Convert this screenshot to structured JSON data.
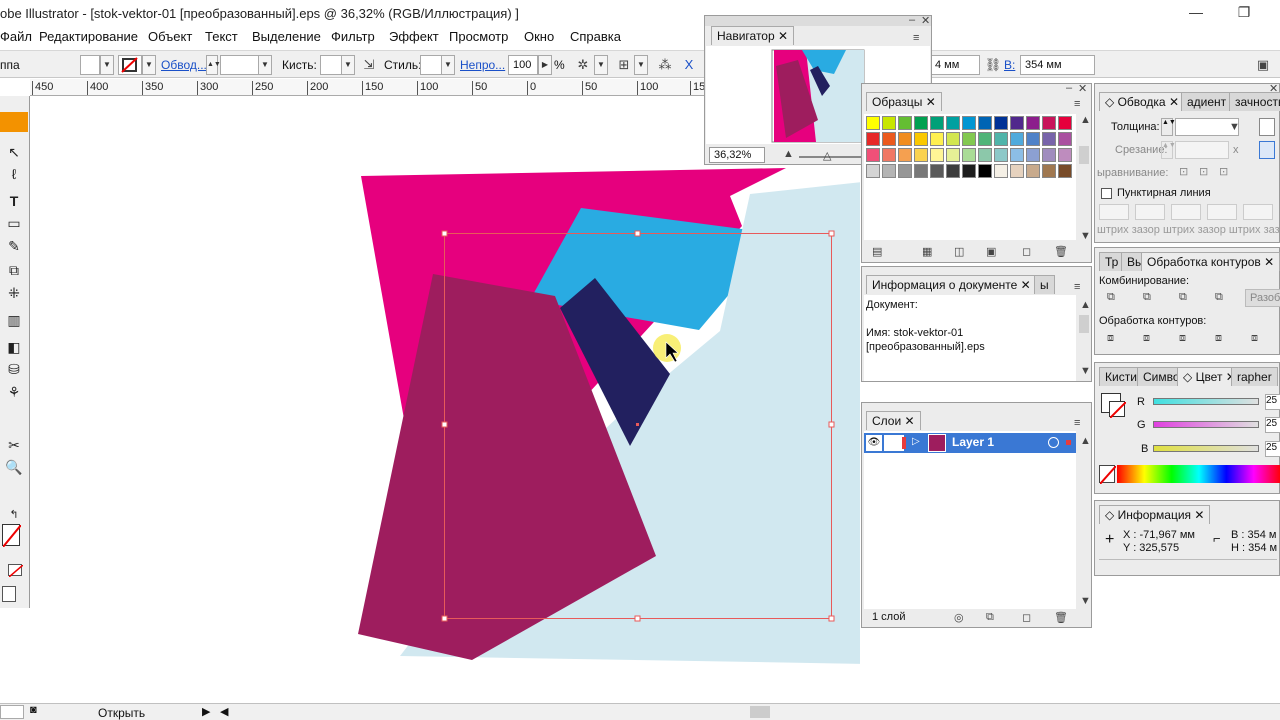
{
  "window": {
    "title": "obe Illustrator - [stok-vektor-01 [преобразованный].eps @ 36,32% (RGB/Иллюстрация) ]",
    "minimize": "—",
    "restore": "❐"
  },
  "menu": [
    "Файл",
    "Редактирование",
    "Объект",
    "Текст",
    "Выделение",
    "Фильтр",
    "Эффект",
    "Просмотр",
    "Окно",
    "Справка"
  ],
  "controlbar": {
    "group_label": "ппа",
    "stroke_link": "Обвод...",
    "brush_label": "Кисть:",
    "style_label": "Стиль:",
    "opacity_link": "Непро...",
    "opacity_value": "100",
    "opacity_unit": "%",
    "w_value": "4 мм",
    "h_label": "В:",
    "h_value": "354 мм"
  },
  "ruler": [
    "450",
    "400",
    "350",
    "300",
    "250",
    "200",
    "150",
    "100",
    "50",
    "0",
    "50",
    "100",
    "150"
  ],
  "navigator": {
    "title": "Навигатор",
    "zoom": "36,32%"
  },
  "swatches": {
    "title": "Образцы",
    "colors": [
      "#ffff00",
      "#c8e600",
      "#64be32",
      "#00a050",
      "#00a078",
      "#00a0a0",
      "#0096d2",
      "#0064b4",
      "#003296",
      "#50288c",
      "#8c1e8c",
      "#c8145a",
      "#e6003c",
      "#e62828",
      "#eb5a1e",
      "#f08c1e",
      "#fac800",
      "#fff050",
      "#d2e650",
      "#82c850",
      "#50b478",
      "#50b4aa",
      "#50aadc",
      "#5082c8",
      "#7864aa",
      "#aa50a0",
      "#f05078",
      "#f07864",
      "#f5a050",
      "#fad250",
      "#fff596",
      "#e6f096",
      "#aadc96",
      "#8cc8aa",
      "#8cc8c8",
      "#8cbee6",
      "#8ca0d2",
      "#a08cbe",
      "#be8cbe",
      "#d4d4d4",
      "#b4b4b4",
      "#969696",
      "#787878",
      "#5a5a5a",
      "#3c3c3c",
      "#1e1e1e",
      "#000000",
      "#f5f0e6",
      "#e6d2be",
      "#c8aa8c",
      "#a07850",
      "#784b28"
    ]
  },
  "docinfo": {
    "title": "Информация о документе",
    "header": "Документ:",
    "name_line1": "Имя: stok-vektor-01",
    "name_line2": "[преобразованный].eps"
  },
  "layers": {
    "title": "Слои",
    "layer_name": "Layer 1",
    "count": "1 слой"
  },
  "stroke": {
    "tab1": "Обводка",
    "tab2": "адиент",
    "tab3": "зачность",
    "thickness_label": "Толщина:",
    "miter_label": "Срезание:",
    "miter_unit": "х",
    "align_label": "ыравнивание:",
    "dashed_label": "Пунктирная линия",
    "dash_labels": [
      "штрих",
      "зазор",
      "штрих",
      "зазор",
      "штрих",
      "зазор"
    ]
  },
  "pathfinder": {
    "tab1": "Тр",
    "tab2": "Вы",
    "tab3": "Обработка контуров",
    "combine_label": "Комбинирование:",
    "expand_btn": "Разоб",
    "process_label": "Обработка контуров:"
  },
  "color": {
    "tab1": "Кисти",
    "tab2": "Симво",
    "tab3": "Цвет",
    "tab4": "rapher",
    "r_label": "R",
    "g_label": "G",
    "b_label": "B",
    "r_value": "25",
    "g_value": "25",
    "b_value": "25"
  },
  "info": {
    "title": "Информация",
    "x_line": "X : -71,967 мм",
    "y_line": "Y : 325,575",
    "w_line": "В : 354 м",
    "h_line": "Н : 354 м"
  },
  "status": {
    "open_label": "Открыть"
  },
  "art_colors": {
    "magenta": "#e6007e",
    "cyan": "#29abe2",
    "navy": "#22205f",
    "lightblue": "#d1e8f0",
    "crimson": "#9e1d5e",
    "selection": "#e85a5a"
  }
}
